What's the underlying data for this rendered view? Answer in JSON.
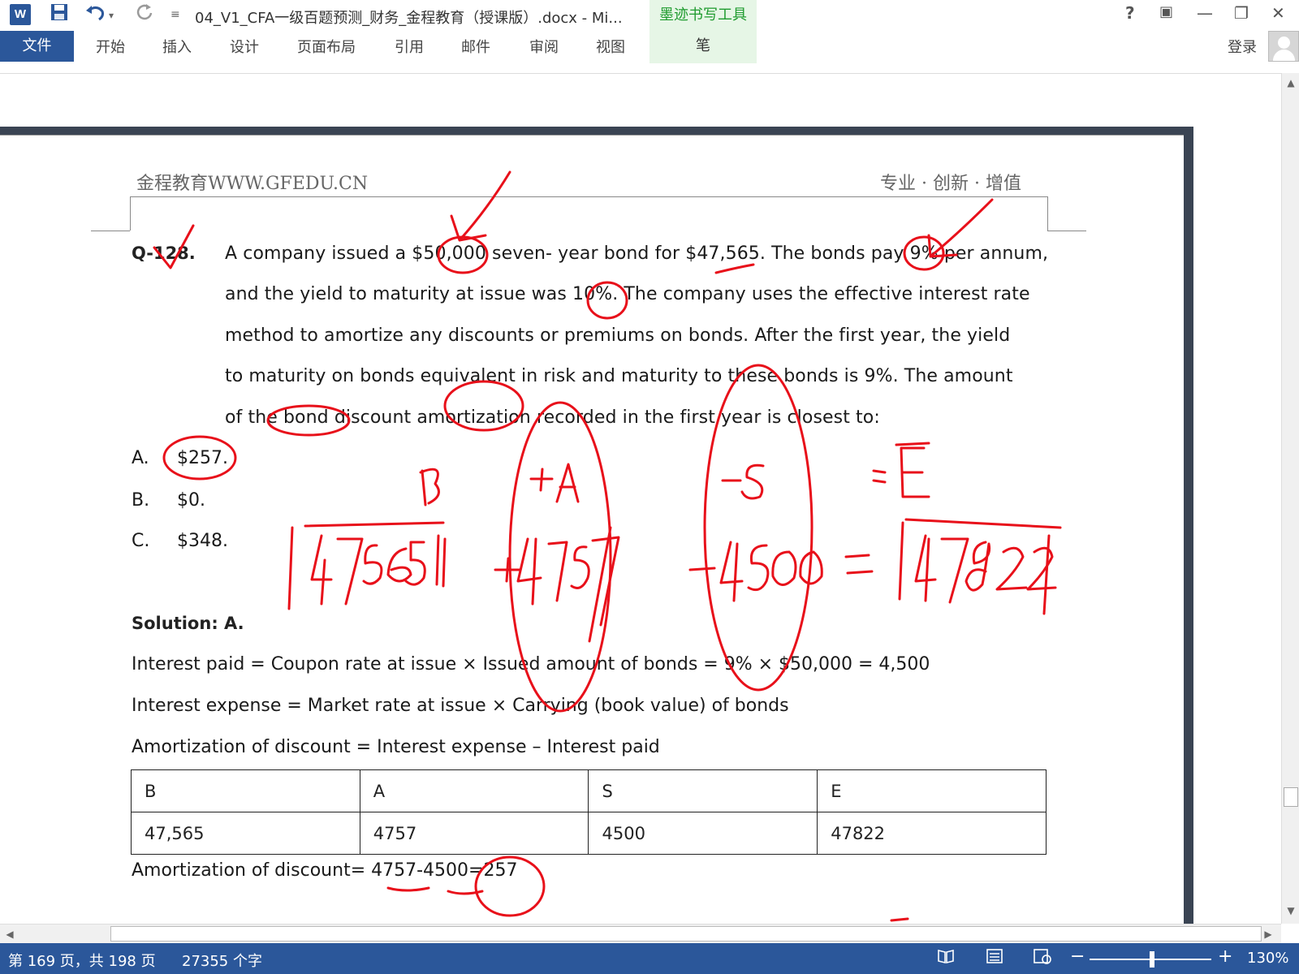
{
  "titlebar": {
    "app_logo": "W",
    "save_icon": "floppy-disk-icon",
    "undo_icon": "undo-icon",
    "redo_icon": "redo-icon",
    "customize_icon": "customize-qat-icon",
    "document_title": "04_V1_CFA一级百题预测_财务_金程教育（授课版）.docx - Mi...",
    "contextual_tab_header": "墨迹书写工具",
    "help": "?",
    "ribbon_display": "▣",
    "minimize": "—",
    "restore": "❐",
    "close": "✕"
  },
  "ribbon": {
    "file": "文件",
    "tabs": [
      "开始",
      "插入",
      "设计",
      "页面布局",
      "引用",
      "邮件",
      "审阅",
      "视图"
    ],
    "pen": "笔",
    "login": "登录"
  },
  "document": {
    "header_left": "金程教育WWW.GFEDU.CN",
    "header_right": "专业 · 创新 · 增值",
    "question_number": "Q-128.",
    "question_lines": [
      "A company issued a $50,000 seven- year bond for $47,565. The bonds pay 9% per annum,",
      "and the yield to maturity at issue was 10%. The company uses the effective interest rate",
      "method to amortize any discounts or premiums on bonds. After the first year, the yield",
      "to maturity on bonds equivalent in risk and maturity to these bonds is 9%. The amount",
      "of the bond discount amortization recorded in the first year is closest to:"
    ],
    "options": [
      {
        "letter": "A.",
        "value": "$257."
      },
      {
        "letter": "B.",
        "value": "$0."
      },
      {
        "letter": "C.",
        "value": "$348."
      }
    ],
    "solution_title": "Solution: A.",
    "solution_lines": [
      "Interest paid = Coupon rate at issue × Issued amount of bonds = 9% × $50,000 = 4,500",
      "Interest expense = Market rate at issue × Carrying (book value) of bonds",
      "Amortization of discount = Interest expense – Interest paid"
    ],
    "table_headers": [
      "B",
      "A",
      "S",
      "E"
    ],
    "table_values": [
      "47,565",
      "4757",
      "4500",
      "47822"
    ],
    "final_line": "Amortization of discount= 4757-4500=257"
  },
  "ink_annotations": {
    "labels": [
      "B",
      "+A",
      "-S",
      "=E"
    ],
    "numbers": [
      "47565",
      "+4757",
      "-4500",
      "=",
      "47822"
    ]
  },
  "statusbar": {
    "page_info": "第 169 页，共 198 页",
    "word_count": "27355 个字",
    "zoom_minus": "−",
    "zoom_plus": "+",
    "zoom_level": "130%"
  },
  "colors": {
    "word_blue": "#2b579a",
    "ink_red": "#e8101a",
    "ink_tab_green": "#1e9b2e"
  }
}
